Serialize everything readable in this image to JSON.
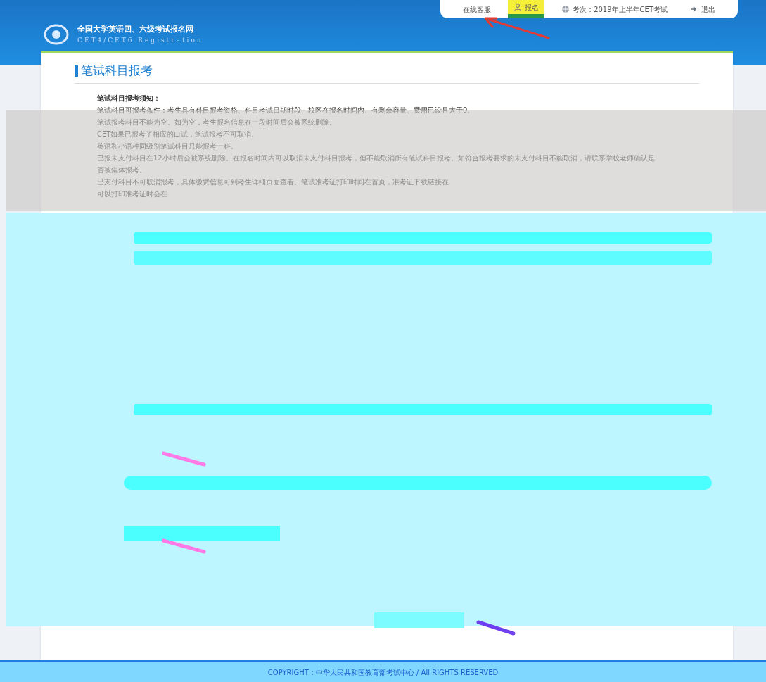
{
  "top_nav": {
    "items": [
      {
        "label": "在线客服",
        "highlighted": false,
        "kind": "plain"
      },
      {
        "label": "报名",
        "highlighted": true,
        "kind": "user"
      },
      {
        "label": "考次：2019年上半年CET考试",
        "highlighted": false,
        "kind": "session"
      },
      {
        "label": "退出",
        "highlighted": false,
        "kind": "logout"
      }
    ]
  },
  "logo": {
    "title": "全国大学英语四、六级考试报名网",
    "subtitle": "CET4/CET6 Registration"
  },
  "section_title": "笔试科目报考",
  "notice": {
    "heading": "笔试科目报考须知：",
    "lines": [
      "笔试科目可报考条件：考生具有科目报考资格、科目考试日期时段、校区在报名时间内、有剩余容量、费用已设且大于0。",
      "笔试报考科目不能为空。如为空，考生报名信息在一段时间后会被系统删除。",
      "CET如果已报考了相应的口试，笔试报考不可取消。",
      "英语和小语种同级别笔试科目只能报考一科。",
      "已报未支付科目在12小时后会被系统删除。在报名时间内可以取消未支付科目报考，但不能取消所有笔试科目报考。如符合报考要求的未支付科目不能取消，请联系学校老师确认是否被集体报考。",
      "已支付科目不可取消报考，具体缴费信息可到考生详细页面查看。笔试准考证打印时间在首页，准考证下载链接在",
      "可以打印准考证时会在"
    ]
  },
  "footer": {
    "copyright": "COPYRIGHT：中华人民共和国教育部考试中心 / All RIGHTS RESERVED"
  }
}
